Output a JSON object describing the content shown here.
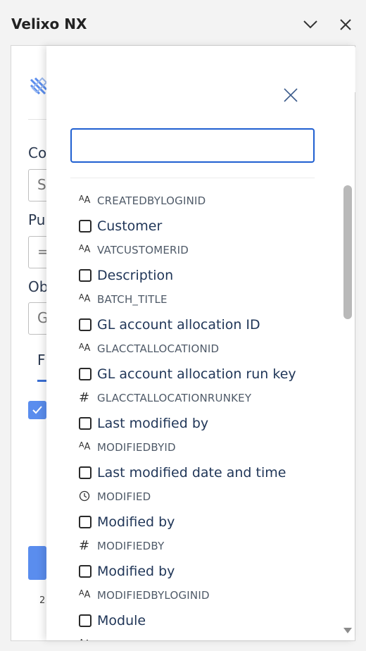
{
  "window": {
    "title": "Velixo NX"
  },
  "icons": {
    "minimize": "chevron-down-icon",
    "close": "close-icon",
    "collapse": "chevron-left-icon",
    "overlay_close": "close-icon",
    "text_type": "text-type-icon",
    "number_type": "hash-icon",
    "datetime_type": "clock-icon"
  },
  "background_panel": {
    "labels": [
      "Co",
      "Pu",
      "Ob"
    ],
    "inputs": [
      "S",
      "=",
      "G"
    ],
    "tab": "F",
    "footer_count": "2"
  },
  "search": {
    "value": "",
    "placeholder": ""
  },
  "fields": [
    {
      "label": "",
      "key": "CREATEDBYLOGINID",
      "type": "text",
      "checkbox": false
    },
    {
      "label": "Customer",
      "key": "VATCUSTOMERID",
      "type": "text",
      "checkbox": true,
      "checked": false
    },
    {
      "label": "Description",
      "key": "BATCH_TITLE",
      "type": "text",
      "checkbox": true,
      "checked": false
    },
    {
      "label": "GL account allocation ID",
      "key": "GLACCTALLOCATIONID",
      "type": "text",
      "checkbox": true,
      "checked": false
    },
    {
      "label": "GL account allocation run key",
      "key": "GLACCTALLOCATIONRUNKEY",
      "type": "number",
      "checkbox": true,
      "checked": false
    },
    {
      "label": "Last modified by",
      "key": "MODIFIEDBYID",
      "type": "text",
      "checkbox": true,
      "checked": false
    },
    {
      "label": "Last modified date and time",
      "key": "MODIFIED",
      "type": "datetime",
      "checkbox": true,
      "checked": false
    },
    {
      "label": "Modified by",
      "key": "MODIFIEDBY",
      "type": "number",
      "checkbox": true,
      "checked": false
    },
    {
      "label": "Modified by",
      "key": "MODIFIEDBYLOGINID",
      "type": "text",
      "checkbox": true,
      "checked": false
    },
    {
      "label": "Module",
      "key": "",
      "type": "text",
      "checkbox": true,
      "checked": false
    }
  ],
  "colors": {
    "accent": "#1f5fd1",
    "label": "#1f3557",
    "key": "#4f5a68",
    "primary_button": "#5a8dee"
  }
}
